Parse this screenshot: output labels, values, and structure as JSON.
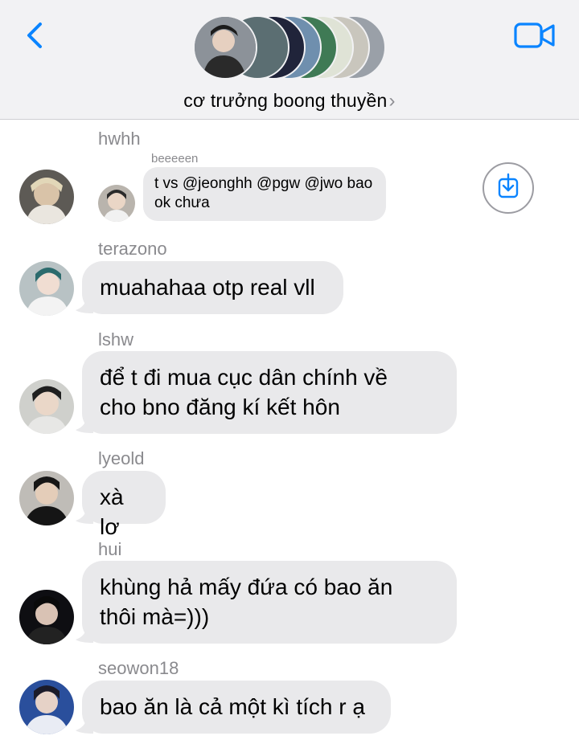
{
  "header": {
    "title": "cơ trưởng boong thuyền",
    "title_chevron": "›",
    "back_icon": "chevron-left-icon",
    "video_icon": "video-camera-icon",
    "accent": "#0a84ff"
  },
  "messages": [
    {
      "sender": "hwhh",
      "quoted_sender": "beeeeen",
      "text_line1": "t vs @jeonghh @pgw @jwo bao",
      "text_line2": "ok chưa"
    },
    {
      "sender": "terazono",
      "text": "muahahaa otp real vll"
    },
    {
      "sender": "lshw",
      "text_line1": "để t đi mua cục dân chính về",
      "text_line2": "cho bno đăng kí kết hôn"
    },
    {
      "sender": "lyeold",
      "text": "xà lơ"
    },
    {
      "sender": "hui",
      "text_line1": "khùng hả mấy đứa có bao ăn",
      "text_line2": "thôi mà=)))"
    },
    {
      "sender": "seowon18",
      "text": "bao ăn là cả một kì tích r ạ"
    }
  ],
  "colors": {
    "bubble": "#e9e9eb",
    "header_bg": "#f2f2f4",
    "sender": "#8a8a8e"
  }
}
